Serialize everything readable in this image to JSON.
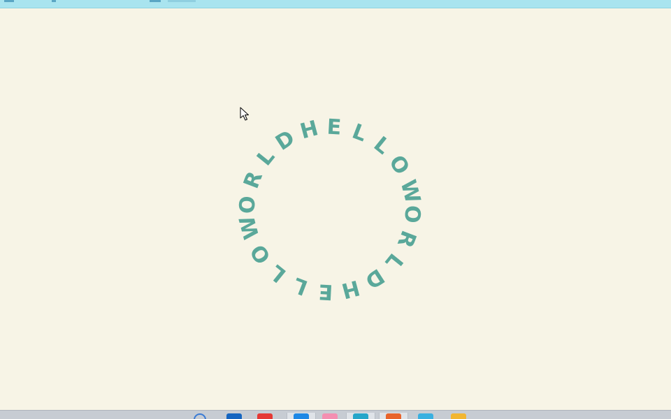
{
  "ring_text": "HELLOWORLDHELLOWORLD",
  "accent_color": "#5aa89a",
  "background_color": "#f7f4e6",
  "taskbar": {
    "icons": [
      {
        "name": "search-icon",
        "color": "#3a7bd5"
      },
      {
        "name": "app-icon-blue",
        "color": "#1565c0"
      },
      {
        "name": "app-icon-red",
        "color": "#e53935"
      },
      {
        "name": "app-icon-vscode",
        "color": "#1e88e5"
      },
      {
        "name": "app-icon-pink",
        "color": "#f48fb1"
      },
      {
        "name": "app-icon-teal",
        "color": "#26a6c9"
      },
      {
        "name": "app-icon-orange",
        "color": "#e8642c"
      },
      {
        "name": "app-icon-screen",
        "color": "#3ab0e0"
      },
      {
        "name": "folder-icon",
        "color": "#f2b632"
      }
    ]
  }
}
